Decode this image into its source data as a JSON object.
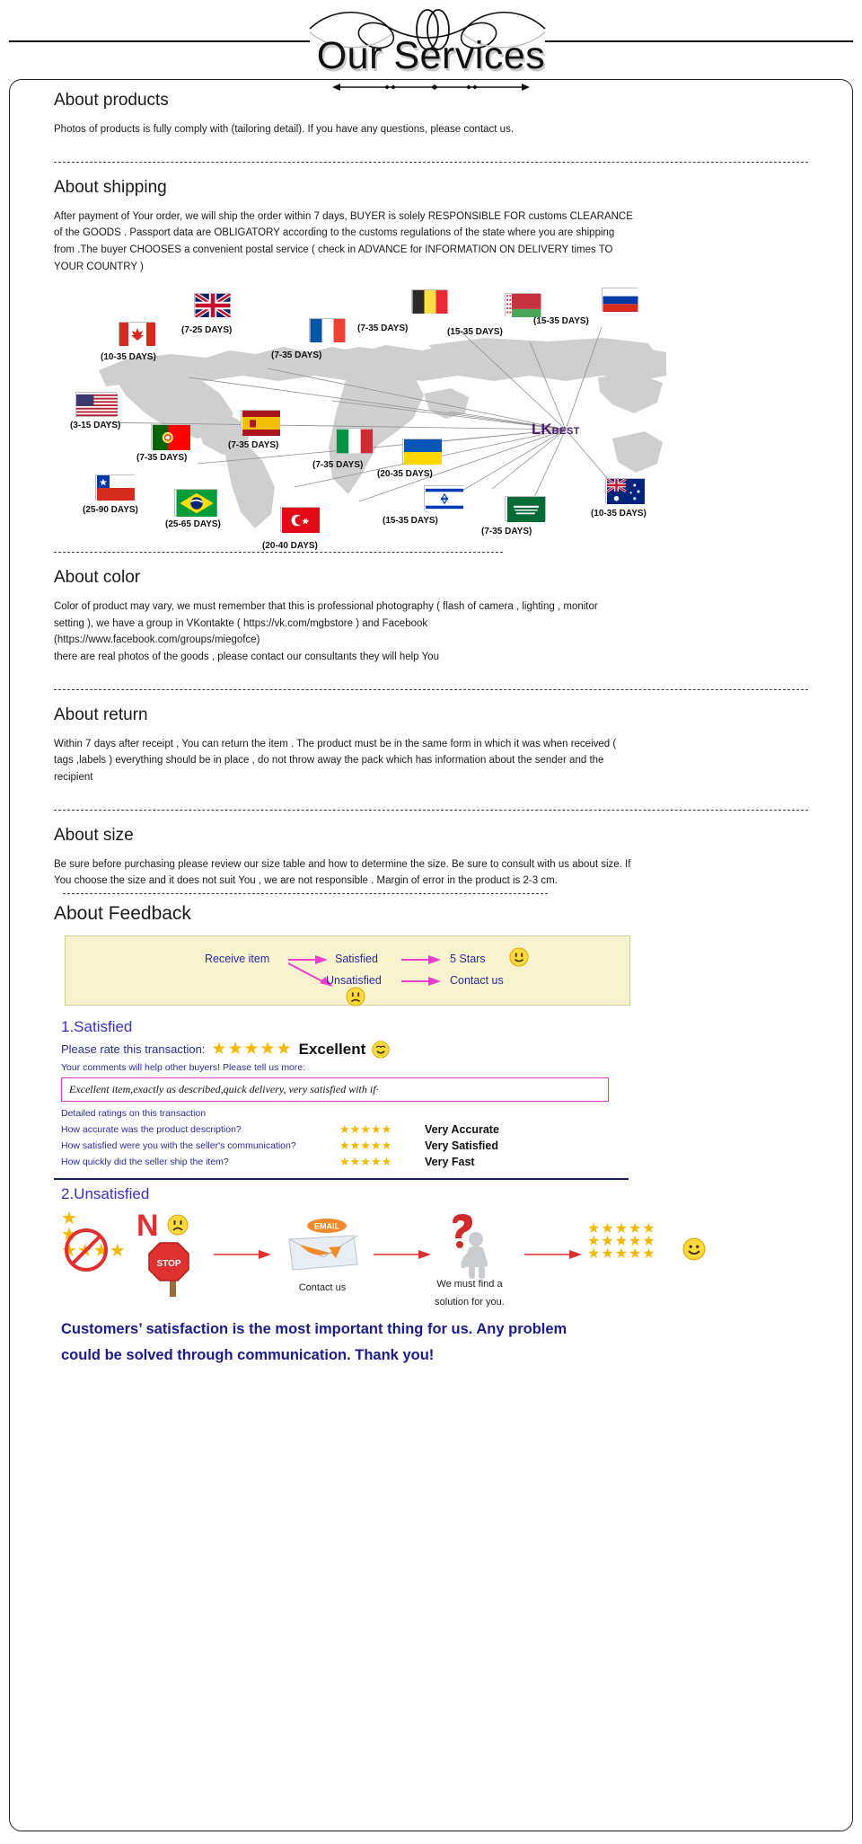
{
  "header": {
    "title": "Our Services"
  },
  "sections": {
    "products": {
      "heading": "About products",
      "body": "Photos of products is fully comply with (tailoring detail). If you have any questions, please contact us."
    },
    "shipping": {
      "heading": "About shipping",
      "body": "After payment of Your order, we will ship the order within 7 days, BUYER is solely RESPONSIBLE FOR customs CLEARANCE of the GOODS . Passport data are OBLIGATORY according to the customs regulations of the state where you are shipping from .The buyer CHOOSES a convenient postal service ( check in ADVANCE for INFORMATION ON DELIVERY times TO YOUR COUNTRY )"
    },
    "color": {
      "heading": "About color",
      "body": "Color of product may vary, we must remember that this is professional photography ( flash of camera , lighting , monitor setting ), we have a group in VKontakte ( https://vk.com/mgbstore ) and Facebook (https://www.facebook.com/groups/miegofce)\n there are real photos of the goods , please contact our consultants they will help You"
    },
    "return": {
      "heading": "About return",
      "body": "Within 7 days after receipt , You can return the item . The product must be in the same form in which it was when received ( tags ,labels ) everything should be in place , do not throw away the pack which has information about the sender and the recipient"
    },
    "size": {
      "heading": "About size",
      "body": "Be sure before purchasing  please review our size table and how to determine the size. Be sure to consult with us about size. If You choose the size and it does not suit You , we are not responsible . Margin of error in the product is 2-3 cm."
    },
    "feedback": {
      "heading": "About Feedback"
    }
  },
  "map": {
    "brand_main": "LK",
    "brand_sub": "BEST",
    "destinations": [
      {
        "country": "United Kingdom",
        "days": "(7-25 DAYS)"
      },
      {
        "country": "Canada",
        "days": "(10-35 DAYS)"
      },
      {
        "country": "France",
        "days": "(7-35 DAYS)"
      },
      {
        "country": "Belgium",
        "days": "(7-35 DAYS)"
      },
      {
        "country": "Belarus",
        "days": "(15-35 DAYS)"
      },
      {
        "country": "Russia",
        "days": "(15-35 DAYS)"
      },
      {
        "country": "United States",
        "days": "(3-15 DAYS)"
      },
      {
        "country": "Portugal",
        "days": "(7-35 DAYS)"
      },
      {
        "country": "Spain",
        "days": "(7-35 DAYS)"
      },
      {
        "country": "Italy",
        "days": "(7-35 DAYS)"
      },
      {
        "country": "Ukraine",
        "days": "(20-35 DAYS)"
      },
      {
        "country": "Chile",
        "days": "(25-90 DAYS)"
      },
      {
        "country": "Brazil",
        "days": "(25-65 DAYS)"
      },
      {
        "country": "Turkey",
        "days": "(20-40 DAYS)"
      },
      {
        "country": "Israel",
        "days": "(15-35 DAYS)"
      },
      {
        "country": "Saudi Arabia",
        "days": "(7-35 DAYS)"
      },
      {
        "country": "Australia",
        "days": "(10-35 DAYS)"
      }
    ]
  },
  "flow": {
    "receive": "Receive item",
    "satisfied": "Satisfied",
    "five_stars": "5 Stars",
    "unsatisfied": "Unsatisfied",
    "contact_us": "Contact us"
  },
  "satisfied": {
    "title": "1.Satisfied",
    "rate_prompt": "Please rate this transaction:",
    "stars": "★★★★★",
    "verdict": "Excellent",
    "subnote": "Your comments will help other buyers! Please tell us more:",
    "comment": "Excellent item,exactly as described,quick delivery,  very satisfied with if·",
    "detailed_heading": "Detailed ratings on this transaction",
    "rows": [
      {
        "question": "How accurate was the product description?",
        "stars": "★★★★★",
        "verdict": "Very Accurate"
      },
      {
        "question": "How satisfied were you with the seller's communication?",
        "stars": "★★★★★",
        "verdict": "Very Satisfied"
      },
      {
        "question": "How quickly did the seller ship the item?",
        "stars": "★★★★★",
        "verdict": "Very Fast"
      }
    ]
  },
  "unsatisfied": {
    "title": "2.Unsatisfied",
    "no_label": "N",
    "stop_label": "STOP",
    "email_label": "EMAIL",
    "contact_caption": "Contact us",
    "solution_caption_line1": "We must find a",
    "solution_caption_line2": "solution for you.",
    "stars_block": "★★★★★"
  },
  "closing": {
    "line1": "Customers’ satisfaction is the most important thing for us. Any problem",
    "line2": "could be solved through communication. Thank you!"
  },
  "colors": {
    "accent_blue": "#2b2b9c",
    "star_gold": "#f5b800",
    "pink_arrow": "#ec3fd0",
    "flow_bg": "#f7f3cf",
    "brand_purple": "#4b1a6f"
  }
}
